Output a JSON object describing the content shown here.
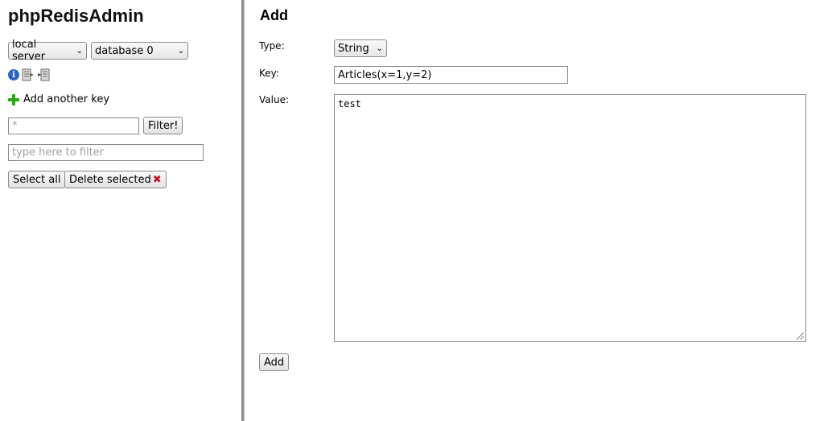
{
  "sidebar": {
    "app_title": "phpRedisAdmin",
    "server_select": {
      "selected": "local server"
    },
    "database_select": {
      "selected": "database 0"
    },
    "add_key_label": "Add another key",
    "pattern_input": {
      "placeholder": "*",
      "value": ""
    },
    "filter_button_label": "Filter!",
    "quick_filter_input": {
      "placeholder": "type here to filter",
      "value": ""
    },
    "select_all_label": "Select all",
    "delete_selected_label": "Delete selected"
  },
  "form": {
    "title": "Add",
    "type_label": "Type:",
    "type_select": {
      "selected": "String"
    },
    "key_label": "Key:",
    "key_value": "Articles(x=1,y=2)",
    "value_label": "Value:",
    "value_text": "test",
    "submit_label": "Add"
  },
  "icons": [
    "info-icon",
    "export-icon",
    "import-icon",
    "plus-icon",
    "x-icon",
    "chevron-down-icon"
  ],
  "colors": {
    "divider": "#8c8c8c",
    "info_icon": "#2e63c7",
    "plus_icon": "#2fa51e",
    "delete_icon": "#c8102e"
  }
}
